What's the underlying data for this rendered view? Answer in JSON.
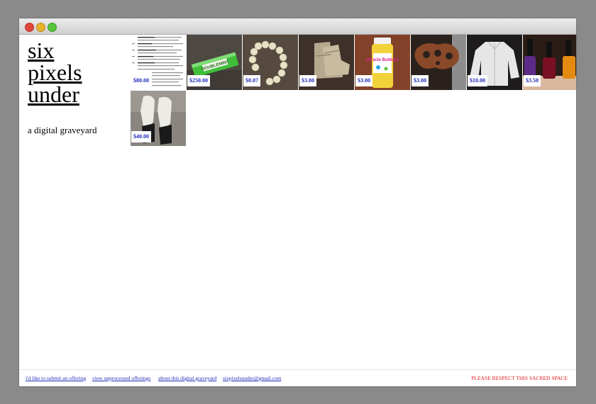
{
  "site": {
    "title_lines": [
      "six",
      "pixels",
      "under"
    ],
    "tagline": "a digital graveyard"
  },
  "offerings": [
    {
      "price": "$80.00",
      "icon": "document-screenshot"
    },
    {
      "price": "$250.00",
      "icon": "doublemint-gum"
    },
    {
      "price": "$0.07",
      "icon": "bead-bracelet"
    },
    {
      "price": "$3.00",
      "icon": "suede-boots"
    },
    {
      "price": "$3.00",
      "icon": "miracle-bubbles-bottle"
    },
    {
      "price": "$3.00",
      "icon": "carved-wood-ornament"
    },
    {
      "price": "$10.00",
      "icon": "white-jacket"
    },
    {
      "price": "$3.50",
      "icon": "nail-polish-bottles"
    },
    {
      "price": "$40.00",
      "icon": "socks-on-feet"
    }
  ],
  "gum_label": "DOUBLEMINT",
  "bubbles_label": "Miracle Bubbles",
  "footer": {
    "links": [
      "i'd like to submit an offering",
      "view unprocessed offerings",
      "about this digital graveyard",
      "sixpixelsunder@gmail.com"
    ],
    "notice": "PLEASE RESPECT THIS SACRED SPACE"
  },
  "colors": {
    "price_text": "#1f2bb8",
    "notice": "#e01b1b",
    "backdrop": "#8a8a8a"
  }
}
